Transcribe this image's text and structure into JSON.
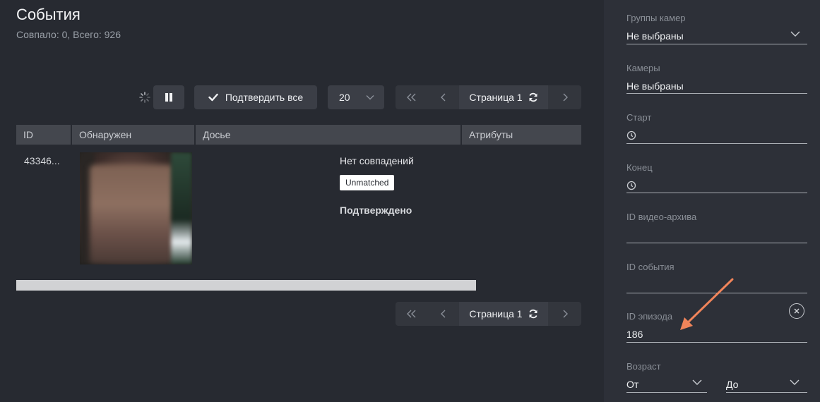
{
  "header": {
    "title": "События",
    "subtitle": "Совпало: 0, Всего: 926"
  },
  "toolbar": {
    "confirm_all_label": "Подтвердить все",
    "per_page_value": "20",
    "pager_label": "Страница 1"
  },
  "table": {
    "columns": [
      "ID",
      "Обнаружен",
      "Досье",
      "Атрибуты"
    ],
    "rows": [
      {
        "id": "43346...",
        "dossier_text": "Нет совпадений",
        "badge": "Unmatched",
        "status": "Подтверждено"
      }
    ]
  },
  "filters": {
    "camera_groups": {
      "label": "Группы камер",
      "value": "Не выбраны"
    },
    "cameras": {
      "label": "Камеры",
      "value": "Не выбраны"
    },
    "start": {
      "label": "Старт"
    },
    "end": {
      "label": "Конец"
    },
    "video_archive_id": {
      "label": "ID видео-архива"
    },
    "event_id": {
      "label": "ID события"
    },
    "episode_id": {
      "label": "ID эпизода",
      "value": "186"
    },
    "age": {
      "label": "Возраст",
      "from": "От",
      "to": "До"
    }
  },
  "colors": {
    "background": "#272a31",
    "sidebar": "#2d3038",
    "button": "#3b3e46",
    "annotation_arrow": "#f0845a"
  }
}
